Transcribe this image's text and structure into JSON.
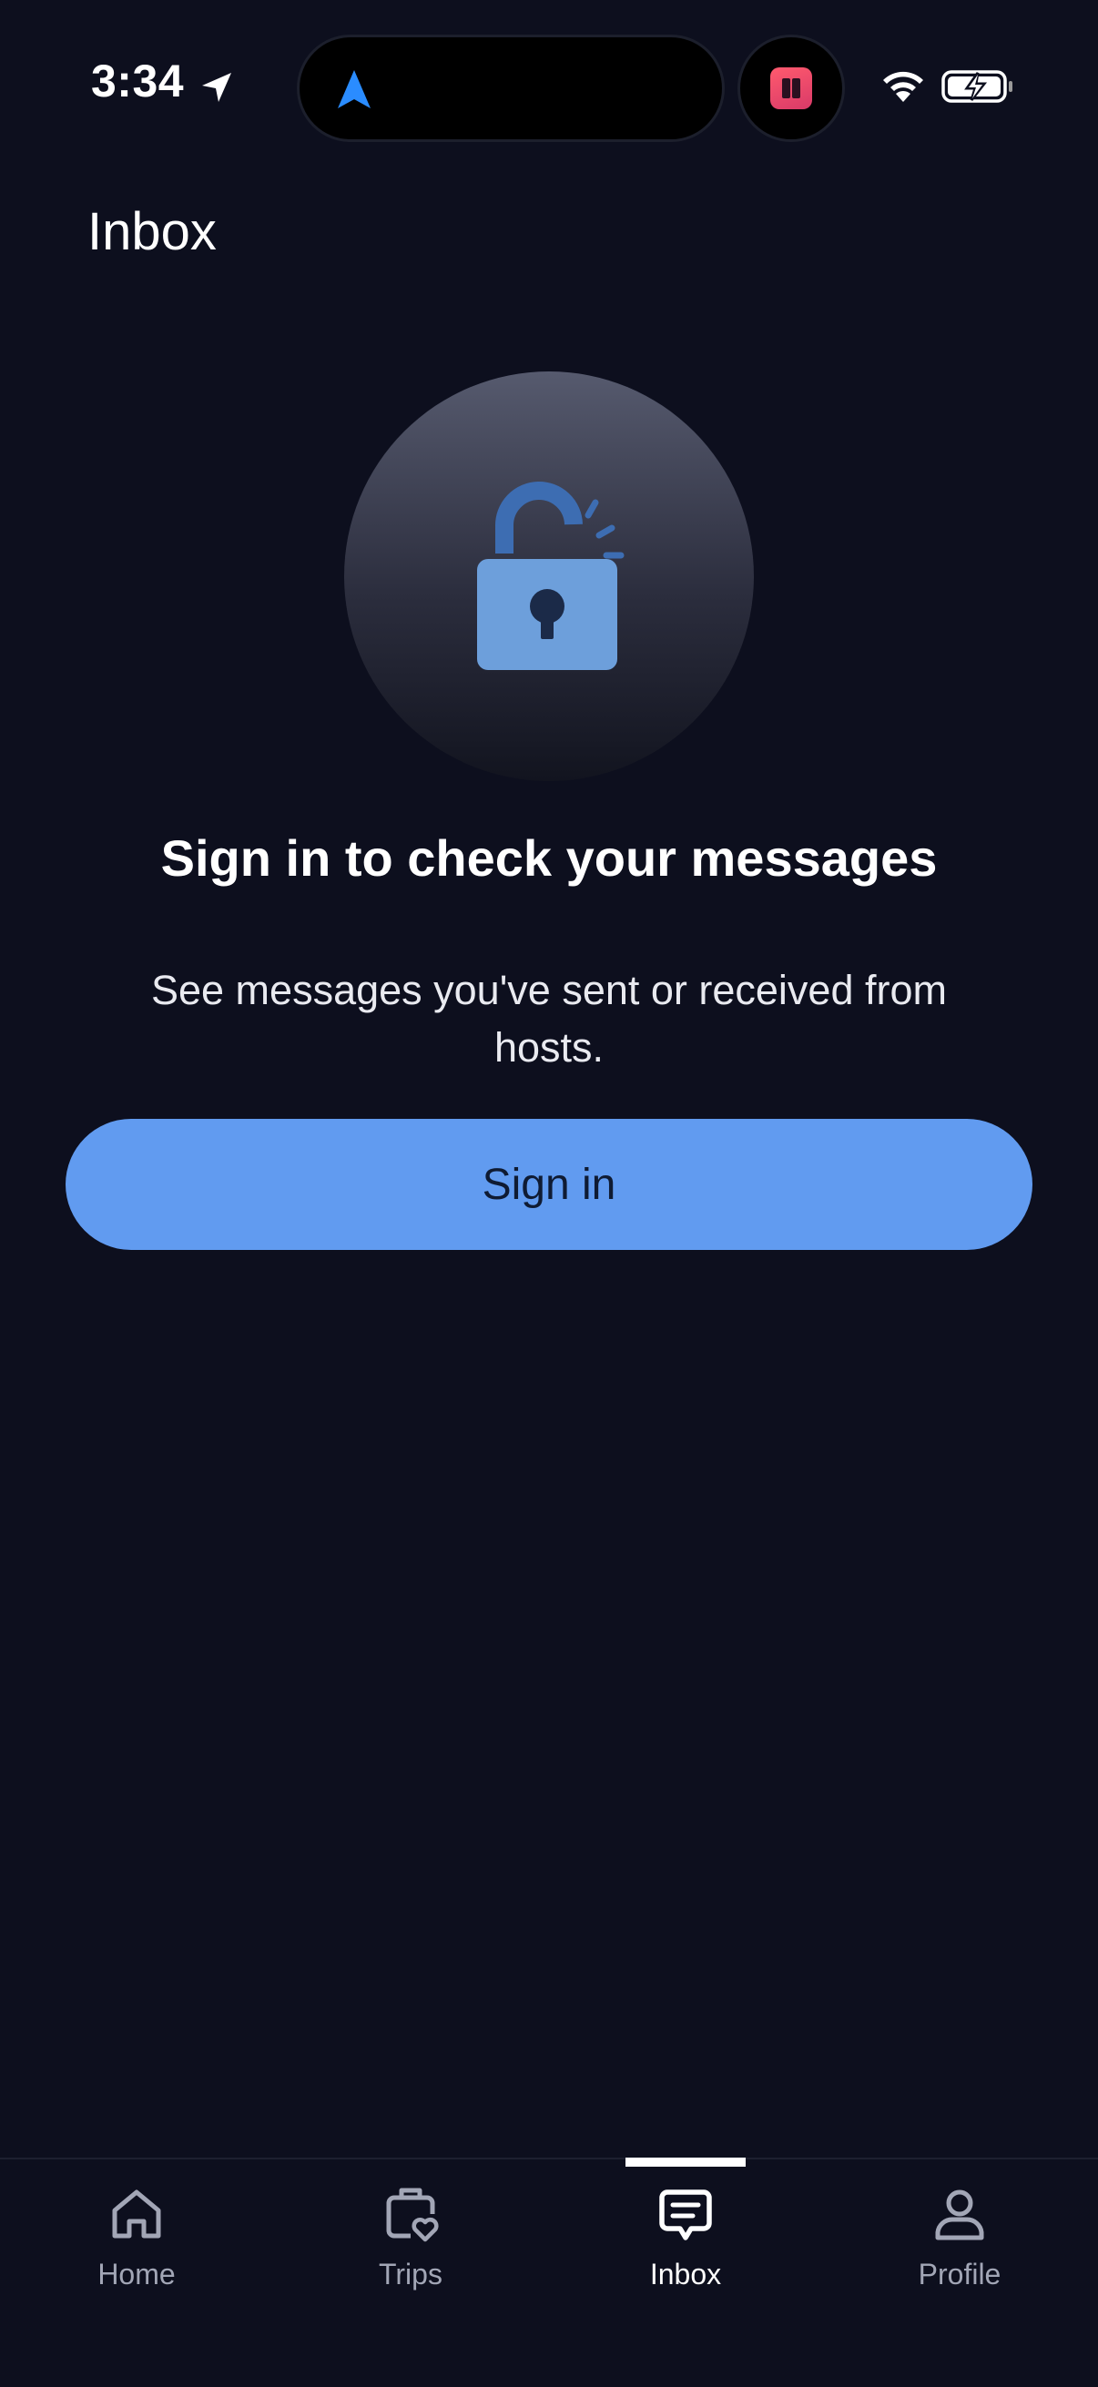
{
  "status_bar": {
    "time": "3:34"
  },
  "header": {
    "title": "Inbox"
  },
  "empty_state": {
    "heading": "Sign in to check your messages",
    "subtext": "See messages you've sent or received from hosts.",
    "icon": "unlocked-padlock-icon"
  },
  "actions": {
    "signin_label": "Sign in"
  },
  "tab_bar": {
    "items": [
      {
        "label": "Home",
        "icon": "home-icon",
        "active": false
      },
      {
        "label": "Trips",
        "icon": "trips-luggage-heart-icon",
        "active": false
      },
      {
        "label": "Inbox",
        "icon": "inbox-message-icon",
        "active": true
      },
      {
        "label": "Profile",
        "icon": "profile-person-icon",
        "active": false
      }
    ]
  },
  "colors": {
    "background": "#0d0f1e",
    "accent": "#619bf0",
    "lock_body": "#6d9fdb",
    "lock_shackle": "#3d6db2",
    "tab_inactive": "#a2a6b6",
    "tab_active": "#ffffff"
  }
}
